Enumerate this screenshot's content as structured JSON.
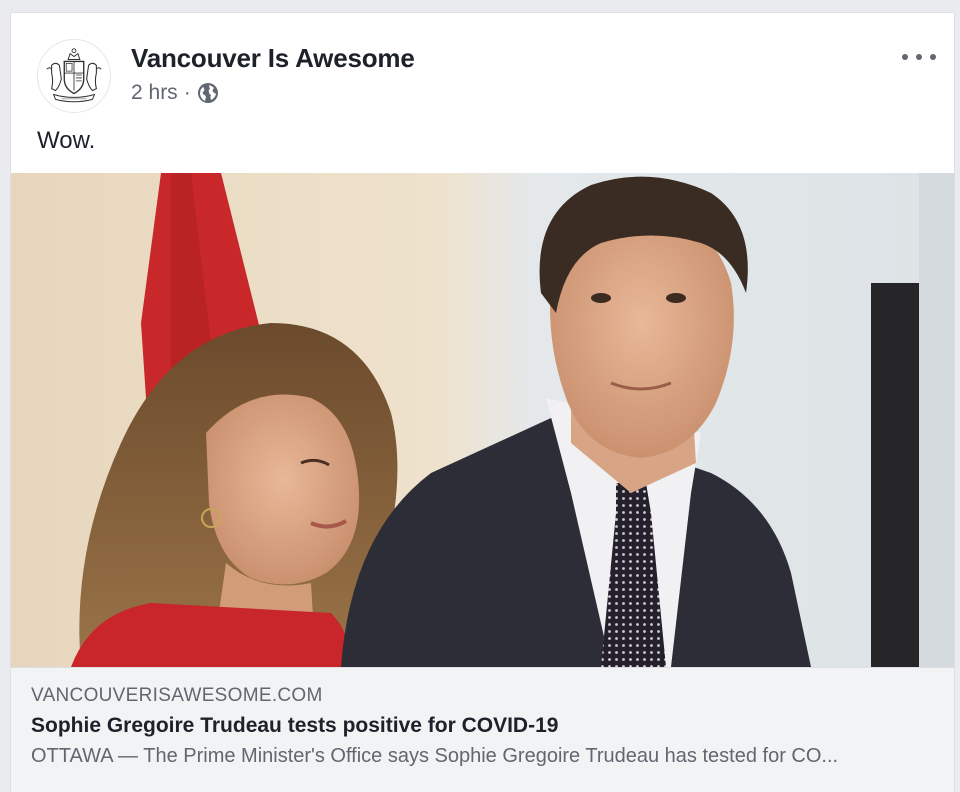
{
  "post": {
    "page_name": "Vancouver Is Awesome",
    "timestamp": "2 hrs",
    "separator": "·",
    "privacy_icon": "globe-icon",
    "menu_icon": "more-options-icon",
    "text": "Wow."
  },
  "link": {
    "domain": "VANCOUVERISAWESOME.COM",
    "title": "Sophie Gregoire Trudeau tests positive for COVID-19",
    "description": "OTTAWA — The Prime Minister's Office says Sophie Gregoire Trudeau has tested for CO..."
  },
  "colors": {
    "name_text": "#1d2129",
    "meta_text": "#606770",
    "card_bg": "#f2f3f5",
    "page_bg": "#e9ebee"
  }
}
